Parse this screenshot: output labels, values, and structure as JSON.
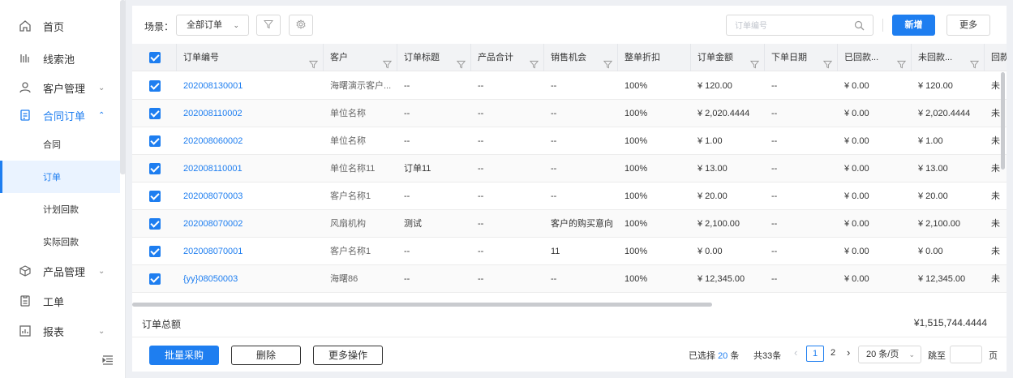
{
  "sidebar": {
    "items": [
      {
        "label": "首页",
        "icon": "home-icon"
      },
      {
        "label": "线索池",
        "icon": "leads-icon"
      },
      {
        "label": "客户管理",
        "icon": "customer-icon"
      },
      {
        "label": "合同订单",
        "icon": "contract-icon"
      },
      {
        "label": "产品管理",
        "icon": "product-icon"
      },
      {
        "label": "工单",
        "icon": "ticket-icon"
      },
      {
        "label": "报表",
        "icon": "report-icon"
      }
    ],
    "sub_items": [
      "合同",
      "订单",
      "计划回款",
      "实际回款"
    ],
    "selected_sub": "订单"
  },
  "toolbar": {
    "scene_label": "场景：",
    "scene_value": "全部订单",
    "search_placeholder": "订单编号",
    "new_label": "新增",
    "more_label": "更多"
  },
  "table": {
    "columns": [
      "订单编号",
      "客户",
      "订单标题",
      "产品合计",
      "销售机会",
      "整单折扣",
      "订单金额",
      "下单日期",
      "已回款...",
      "未回款...",
      "回款"
    ],
    "rows": [
      [
        "202008130001",
        "海曙演示客户...",
        "--",
        "--",
        "--",
        "100%",
        "¥ 120.00",
        "--",
        "¥ 0.00",
        "¥ 120.00",
        "未"
      ],
      [
        "202008110002",
        "单位名称",
        "--",
        "--",
        "--",
        "100%",
        "¥ 2,020.4444",
        "--",
        "¥ 0.00",
        "¥ 2,020.4444",
        "未"
      ],
      [
        "202008060002",
        "单位名称",
        "--",
        "--",
        "--",
        "100%",
        "¥ 1.00",
        "--",
        "¥ 0.00",
        "¥ 1.00",
        "未"
      ],
      [
        "202008110001",
        "单位名称11",
        "订单11",
        "--",
        "--",
        "100%",
        "¥ 13.00",
        "--",
        "¥ 0.00",
        "¥ 13.00",
        "未"
      ],
      [
        "202008070003",
        "客户名称1",
        "--",
        "--",
        "--",
        "100%",
        "¥ 20.00",
        "--",
        "¥ 0.00",
        "¥ 20.00",
        "未"
      ],
      [
        "202008070002",
        "风扇机构",
        "测试",
        "--",
        "客户的购买意向",
        "100%",
        "¥ 2,100.00",
        "--",
        "¥ 0.00",
        "¥ 2,100.00",
        "未"
      ],
      [
        "202008070001",
        "客户名称1",
        "--",
        "--",
        "11",
        "100%",
        "¥ 0.00",
        "--",
        "¥ 0.00",
        "¥ 0.00",
        "未"
      ],
      [
        "{yy}08050003",
        "海曙86",
        "--",
        "--",
        "--",
        "100%",
        "¥ 12,345.00",
        "--",
        "¥ 0.00",
        "¥ 12,345.00",
        "未"
      ]
    ]
  },
  "summary": {
    "label": "订单总额",
    "value": "¥1,515,744.4444"
  },
  "footer": {
    "batch_purchase": "批量采购",
    "delete": "删除",
    "more_actions": "更多操作",
    "selected_prefix": "已选择",
    "selected_count": "20",
    "selected_suffix": "条",
    "total": "共33条",
    "pages": [
      "1",
      "2"
    ],
    "current_page": "1",
    "page_size": "20 条/页",
    "jump_label": "跳至",
    "page_unit": "页"
  },
  "colors": {
    "accent": "#1e7ef0",
    "header_bg": "#f2f3f5",
    "page_bg": "#eef0f4"
  }
}
